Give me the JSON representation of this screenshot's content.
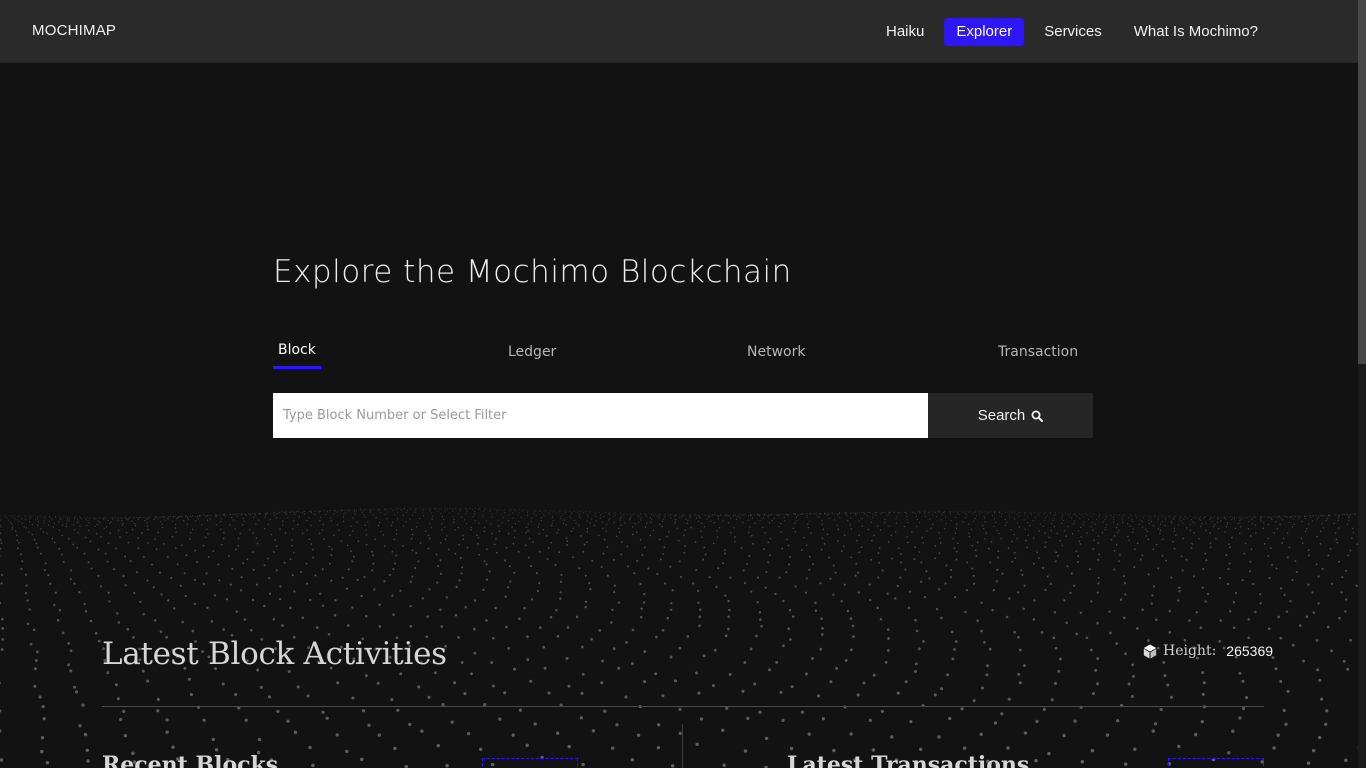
{
  "header": {
    "brand": "MOCHIMAP",
    "nav": [
      {
        "label": "Haiku",
        "active": false
      },
      {
        "label": "Explorer",
        "active": true
      },
      {
        "label": "Services",
        "active": false
      },
      {
        "label": "What Is Mochimo?",
        "active": false
      }
    ]
  },
  "hero": {
    "title": "Explore the Mochimo Blockchain",
    "tabs": [
      {
        "label": "Block",
        "active": true
      },
      {
        "label": "Ledger",
        "active": false
      },
      {
        "label": "Network",
        "active": false
      },
      {
        "label": "Transaction",
        "active": false
      }
    ],
    "search": {
      "placeholder": "Type Block Number or Select Filter",
      "value": "",
      "button_label": "Search",
      "button_icon": "search-icon"
    }
  },
  "activities": {
    "title": "Latest Block Activities",
    "height_label": "Height:",
    "height_value": "265369",
    "height_icon": "cube-icon",
    "recent_blocks_title": "Recent Blocks",
    "latest_transactions_title": "Latest Transactions"
  },
  "colors": {
    "accent": "#2f16f5",
    "background": "#121212",
    "header": "#2a2a2a"
  }
}
